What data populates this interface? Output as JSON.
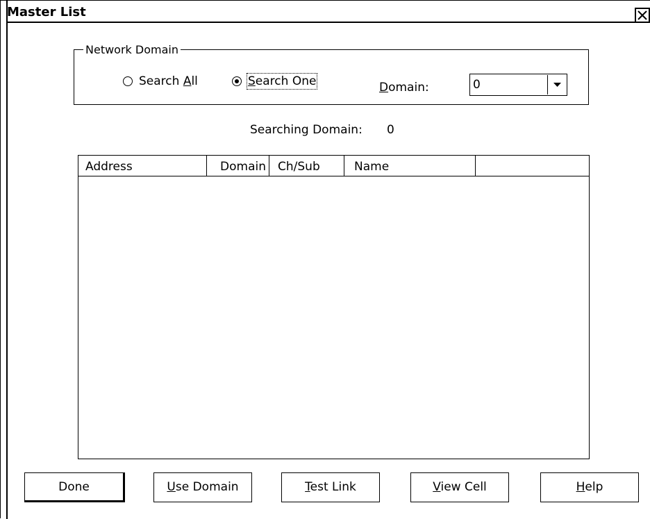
{
  "window": {
    "title": "Master List",
    "close_icon": "close-icon"
  },
  "network_domain": {
    "legend": "Network Domain",
    "search_all": {
      "prefix": "Search ",
      "mnemonic": "A",
      "suffix": "ll",
      "selected": false
    },
    "search_one": {
      "prefix": "",
      "mnemonic": "S",
      "suffix": "earch One",
      "selected": true
    },
    "domain_label": {
      "mnemonic": "D",
      "suffix": "omain:"
    },
    "domain_value": "0",
    "dropdown_icon": "chevron-down-icon"
  },
  "status": {
    "searching_label": "Searching Domain:",
    "searching_value": "0"
  },
  "list": {
    "columns": [
      "Address",
      "Domain",
      "Ch/Sub",
      "Name",
      ""
    ],
    "rows": []
  },
  "buttons": {
    "done": {
      "prefix": "Done",
      "mnemonic": "",
      "suffix": ""
    },
    "use_domain": {
      "prefix": "",
      "mnemonic": "U",
      "suffix": "se Domain"
    },
    "test_link": {
      "prefix": "",
      "mnemonic": "T",
      "suffix": "est Link"
    },
    "view_cell": {
      "prefix": "",
      "mnemonic": "V",
      "suffix": "iew Cell"
    },
    "help": {
      "prefix": "",
      "mnemonic": "H",
      "suffix": "elp"
    }
  }
}
